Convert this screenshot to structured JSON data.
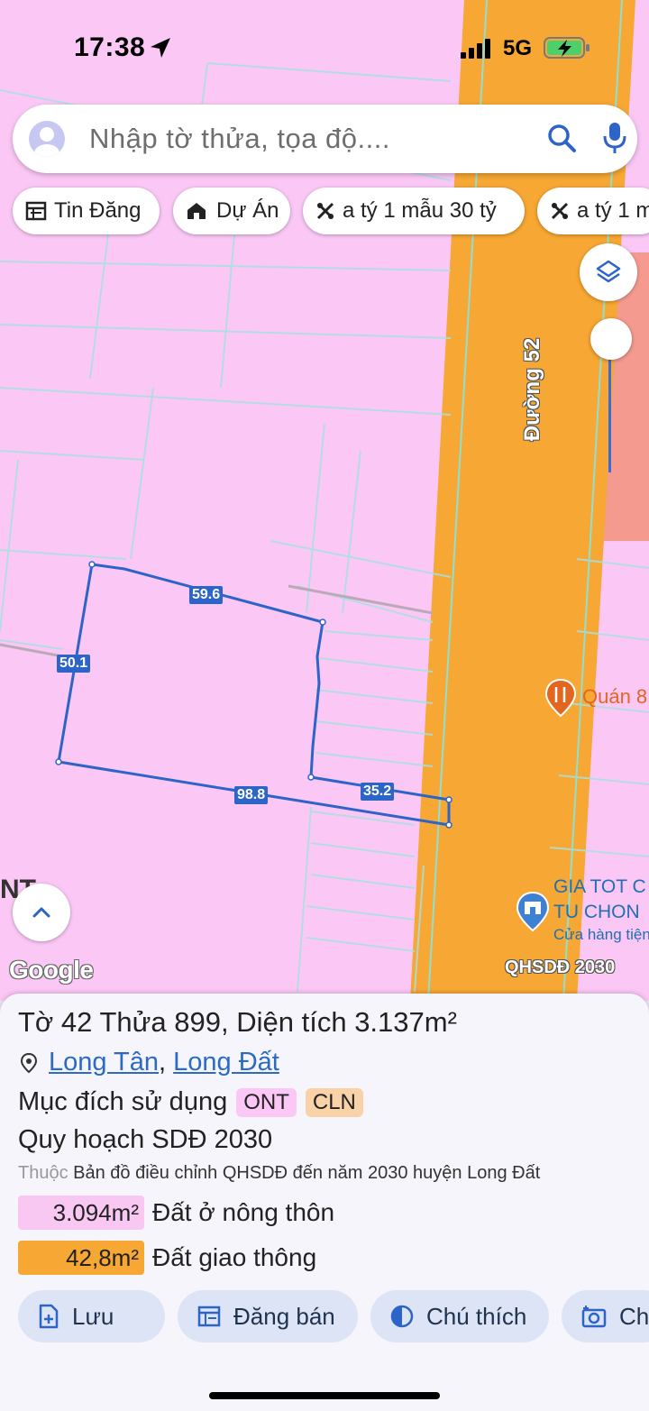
{
  "status_bar": {
    "time": "17:38",
    "network": "5G"
  },
  "search": {
    "placeholder": "Nhập tờ thửa, tọa độ...."
  },
  "chips": [
    "Tin Đăng",
    "Dự Án",
    "a tý 1 mẫu 30 tỷ",
    "a tý 1 m"
  ],
  "map": {
    "road_name": "Đường 52",
    "dimensions": [
      "59.6",
      "50.1",
      "98.8",
      "35.2"
    ],
    "poi": {
      "restaurant": "Quán 8",
      "store_name_1": "GIA TOT C",
      "store_name_2": "TU CHON",
      "store_subtitle": "Cửa hàng tiện"
    },
    "zone_label": "NT",
    "logo": "Google",
    "source": "QHSDĐ 2030"
  },
  "parcel": {
    "to_label": "Tờ",
    "to_number": "42",
    "thua_label": "Thửa",
    "thua_number": "899",
    "area_label": "Diện tích",
    "area_value": "3.137m²",
    "location_1": "Long Tân",
    "location_2": "Long Đất",
    "purpose_label": "Mục đích sử dụng",
    "purpose_tags": [
      "ONT",
      "CLN"
    ],
    "plan_title": "Quy hoạch SDĐ 2030",
    "plan_prefix": "Thuộc",
    "plan_source": "Bản đồ điều chỉnh QHSDĐ đến năm 2030 huyện Long Đất",
    "areas": [
      {
        "value": "3.094m²",
        "label": "Đất ở nông thôn",
        "color": "#f8c8f3"
      },
      {
        "value": "42,8m²",
        "label": "Đất giao thông",
        "color": "#f7a733"
      }
    ]
  },
  "actions": [
    "Lưu",
    "Đăng bán",
    "Chú thích",
    "Ch"
  ],
  "colors": {
    "residential": "#fbc8f6",
    "road": "#f7a733",
    "commercial": "#f59a8f",
    "boundary": "#2d64c8"
  }
}
